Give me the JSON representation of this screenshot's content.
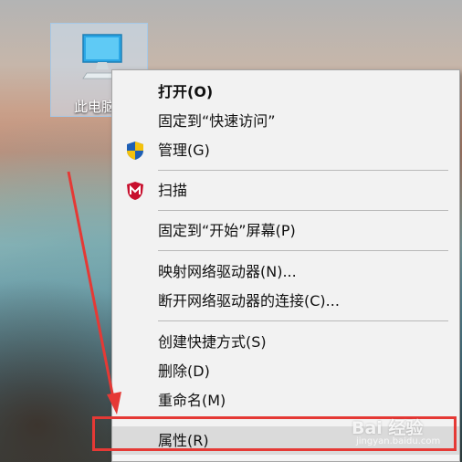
{
  "desktop": {
    "icon_label": "此电脑"
  },
  "context_menu": {
    "items": [
      {
        "label": "打开(O)",
        "bold": true
      },
      {
        "label": "固定到“快速访问”"
      },
      {
        "label": "管理(G)",
        "icon": "shield-icon"
      },
      {
        "label": "扫描",
        "icon": "mcafee-icon"
      },
      {
        "label": "固定到“开始”屏幕(P)"
      },
      {
        "label": "映射网络驱动器(N)..."
      },
      {
        "label": "断开网络驱动器的连接(C)..."
      },
      {
        "label": "创建快捷方式(S)"
      },
      {
        "label": "删除(D)"
      },
      {
        "label": "重命名(M)"
      },
      {
        "label": "属性(R)",
        "highlighted": true
      }
    ]
  },
  "watermark": {
    "text": "Bai 经验",
    "sub": "jingyan.baidu.com"
  },
  "colors": {
    "annotation": "#e53935",
    "menu_bg": "#f2f2f2"
  }
}
